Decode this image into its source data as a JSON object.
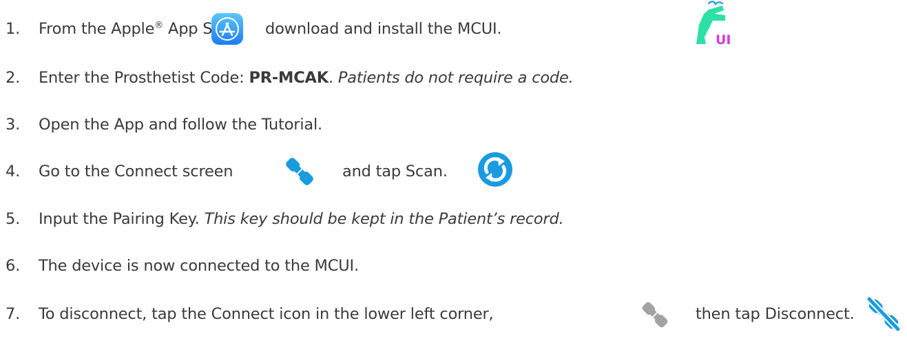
{
  "steps": [
    {
      "num": "1.",
      "a": "From the Apple",
      "sup": "®",
      "b": " App Store",
      "c": "download and install the MCUI.",
      "icons": [
        "app-store-icon",
        "mcui-logo-icon"
      ]
    },
    {
      "num": "2.",
      "a": "Enter the Prosthetist Code: ",
      "bold": "PR-MCAK",
      "b": ". ",
      "italic": "Patients do not require a code."
    },
    {
      "num": "3.",
      "a": "Open the App and follow the Tutorial."
    },
    {
      "num": "4.",
      "a": "Go to the Connect screen",
      "c": "and tap Scan.",
      "icons": [
        "connect-plug-icon",
        "scan-refresh-icon"
      ]
    },
    {
      "num": "5.",
      "a": "Input the Pairing Key. ",
      "italic": "This key should be kept in the Patient’s record."
    },
    {
      "num": "6.",
      "a": "The device is now connected to the MCUI."
    },
    {
      "num": "7.",
      "a": "To disconnect, tap the Connect icon in the lower left corner,",
      "c": "then tap Disconnect.",
      "icons": [
        "connect-plug-grey-icon",
        "disconnect-icon"
      ]
    }
  ],
  "colors": {
    "text": "#3a3a3a",
    "blue": "#1a9be0",
    "green": "#2de0a6",
    "magenta": "#d53bd8",
    "grey": "#a3a3a3"
  }
}
